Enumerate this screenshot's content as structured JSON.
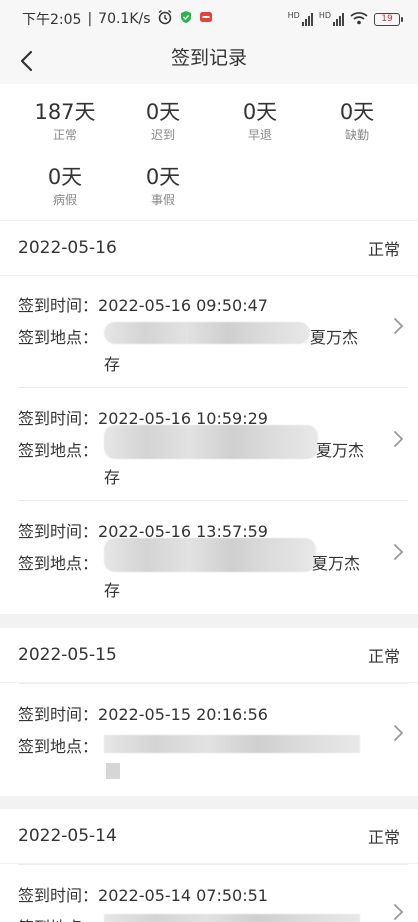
{
  "status_bar": {
    "time": "下午2:05",
    "speed": "70.1K/s",
    "battery": "19",
    "hd1": "HD",
    "hd2": "HD"
  },
  "nav": {
    "title": "签到记录"
  },
  "stats": [
    {
      "value": "187天",
      "label": "正常"
    },
    {
      "value": "0天",
      "label": "迟到"
    },
    {
      "value": "0天",
      "label": "早退"
    },
    {
      "value": "0天",
      "label": "缺勤"
    },
    {
      "value": "0天",
      "label": "病假"
    },
    {
      "value": "0天",
      "label": "事假"
    }
  ],
  "labels": {
    "sign_time": "签到时间：",
    "sign_place": "签到地点："
  },
  "groups": [
    {
      "date": "2022-05-16",
      "status": "正常",
      "records": [
        {
          "time": "2022-05-16 09:50:47",
          "place_visible": "夏万杰",
          "place_wrap": "存"
        },
        {
          "time": "2022-05-16 10:59:29",
          "place_visible": "夏万杰",
          "place_wrap": "存"
        },
        {
          "time": "2022-05-16 13:57:59",
          "place_visible": "夏万杰",
          "place_wrap": "存"
        }
      ]
    },
    {
      "date": "2022-05-15",
      "status": "正常",
      "records": [
        {
          "time": "2022-05-15 20:16:56"
        }
      ]
    },
    {
      "date": "2022-05-14",
      "status": "正常",
      "records": [
        {
          "time": "2022-05-14 07:50:51"
        }
      ]
    }
  ]
}
